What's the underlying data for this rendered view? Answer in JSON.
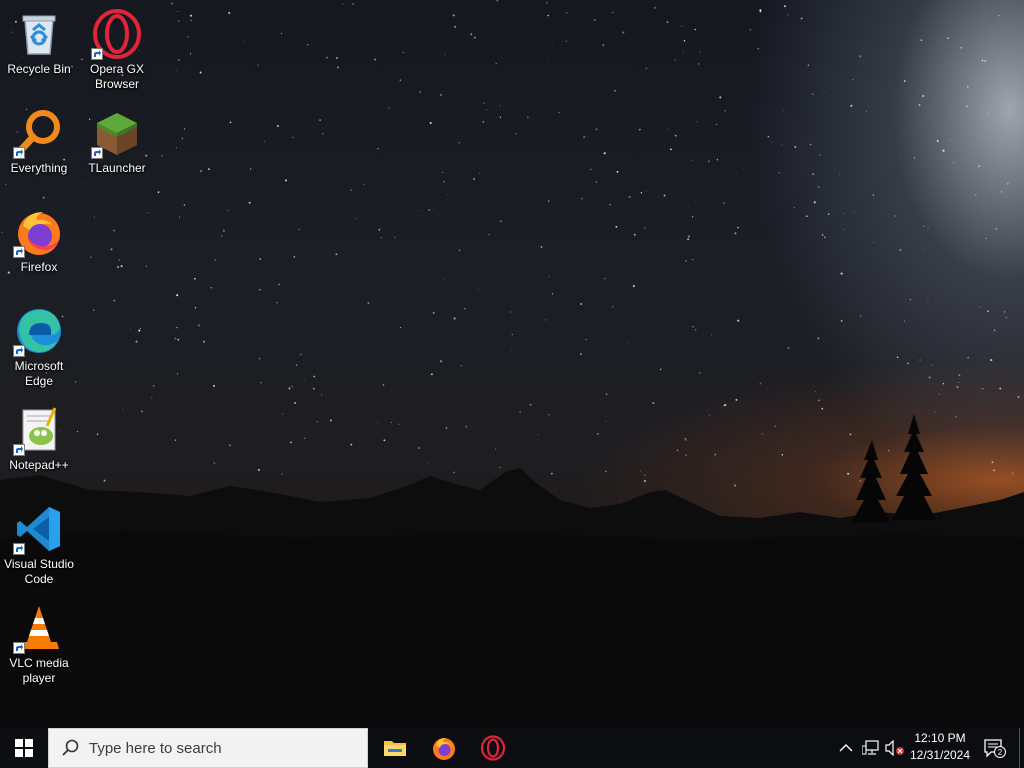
{
  "desktop": {
    "icons": [
      {
        "label": "Recycle Bin",
        "icon": "recycle-bin-icon"
      },
      {
        "label": "Opera GX Browser",
        "icon": "opera-gx-icon"
      },
      {
        "label": "Everything",
        "icon": "everything-search-icon"
      },
      {
        "label": "TLauncher",
        "icon": "tlauncher-icon"
      },
      {
        "label": "Firefox",
        "icon": "firefox-icon"
      },
      {
        "label": "Microsoft Edge",
        "icon": "edge-icon"
      },
      {
        "label": "Notepad++",
        "icon": "notepadpp-icon"
      },
      {
        "label": "Visual Studio Code",
        "icon": "vscode-icon"
      },
      {
        "label": "VLC media player",
        "icon": "vlc-icon"
      }
    ]
  },
  "taskbar": {
    "search_placeholder": "Type here to search",
    "pinned": [
      {
        "name": "File Explorer",
        "icon": "file-explorer-icon"
      },
      {
        "name": "Firefox",
        "icon": "firefox-icon"
      },
      {
        "name": "Opera GX",
        "icon": "opera-gx-icon"
      }
    ],
    "tray": {
      "time": "12:10 PM",
      "date": "12/31/2024",
      "notification_count": "2",
      "volume_muted": true
    }
  },
  "colors": {
    "taskbar_bg": "#0c0d10",
    "search_bg": "#f2f2f2",
    "opera_red": "#e0243c",
    "windows_blue": "#ffffff"
  }
}
